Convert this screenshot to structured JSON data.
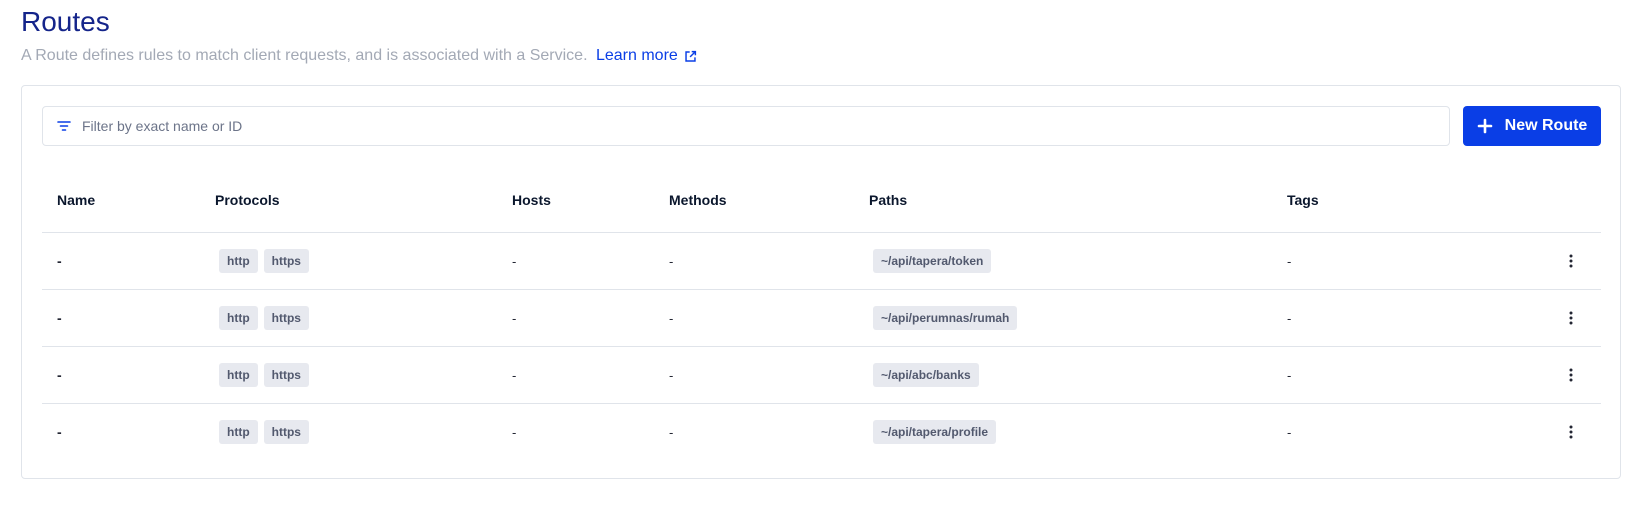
{
  "header": {
    "title": "Routes",
    "description": "A Route defines rules to match client requests, and is associated with a Service.",
    "learn_more": "Learn more"
  },
  "toolbar": {
    "filter_placeholder": "Filter by exact name or ID",
    "new_route_label": "New Route"
  },
  "colors": {
    "brand": "#0a3ee6",
    "title": "#14248a",
    "muted": "#a3a9b5",
    "badge_bg": "#e7e9ef"
  },
  "table": {
    "columns": [
      "Name",
      "Protocols",
      "Hosts",
      "Methods",
      "Paths",
      "Tags"
    ],
    "rows": [
      {
        "name": "-",
        "protocols": [
          "http",
          "https"
        ],
        "hosts": "-",
        "methods": "-",
        "path": "~/api/tapera/token",
        "tags": "-"
      },
      {
        "name": "-",
        "protocols": [
          "http",
          "https"
        ],
        "hosts": "-",
        "methods": "-",
        "path": "~/api/perumnas/rumah",
        "tags": "-"
      },
      {
        "name": "-",
        "protocols": [
          "http",
          "https"
        ],
        "hosts": "-",
        "methods": "-",
        "path": "~/api/abc/banks",
        "tags": "-"
      },
      {
        "name": "-",
        "protocols": [
          "http",
          "https"
        ],
        "hosts": "-",
        "methods": "-",
        "path": "~/api/tapera/profile",
        "tags": "-"
      }
    ]
  }
}
